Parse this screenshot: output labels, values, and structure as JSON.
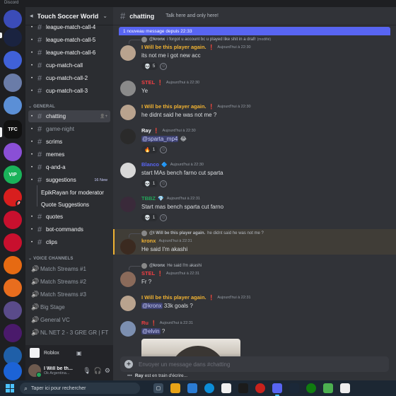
{
  "app": {
    "title": "Discord"
  },
  "rail": {
    "servers": [
      {
        "label": "",
        "color": "#3b4cb8"
      },
      {
        "label": "",
        "color": "#1a2340",
        "badge": ""
      },
      {
        "label": "",
        "color": "#4061d8"
      },
      {
        "label": "",
        "color": "#6a7ca8"
      },
      {
        "label": "",
        "color": "#5b8fd6"
      },
      {
        "label": "TFC",
        "color": "#111111"
      },
      {
        "label": "",
        "color": "#8a4fd6"
      },
      {
        "label": "VIP",
        "color": "#1ab35a"
      },
      {
        "label": "",
        "color": "#d81e1e",
        "badge": "1"
      },
      {
        "label": "",
        "color": "#c8102e"
      },
      {
        "label": "",
        "color": "#c8102e"
      },
      {
        "label": "",
        "color": "#e66a12"
      },
      {
        "label": "",
        "color": "#e86d1e",
        "badge": ""
      },
      {
        "label": "",
        "color": "#5a4b8a"
      },
      {
        "label": "",
        "color": "#4a1a6b"
      },
      {
        "label": "",
        "color": "#1f5fa8"
      },
      {
        "label": "",
        "color": "#1c63d6"
      }
    ]
  },
  "guild": {
    "name": "Touch Soccer World"
  },
  "sidebar": {
    "top_channels": [
      {
        "name": "league-match-call-4"
      },
      {
        "name": "league-match-call-5"
      },
      {
        "name": "league-match-call-6"
      },
      {
        "name": "cup-match-call"
      },
      {
        "name": "cup-match-call-2"
      },
      {
        "name": "cup-match-call-3"
      }
    ],
    "category_general": "GENERAL",
    "general_channels": [
      {
        "name": "chatting",
        "active": true
      },
      {
        "name": "game-night",
        "dim": true
      },
      {
        "name": "scrims"
      },
      {
        "name": "memes"
      },
      {
        "name": "q-and-a"
      },
      {
        "name": "suggestions",
        "badge": "16 New"
      }
    ],
    "threads": [
      "EpikRayan for moderator",
      "Quote Suggestions"
    ],
    "more_channels": [
      {
        "name": "quotes"
      },
      {
        "name": "bot-commands"
      },
      {
        "name": "clips"
      }
    ],
    "category_voice": "VOICE CHANNELS",
    "voice_channels": [
      {
        "name": "Match Streams #1"
      },
      {
        "name": "Match Streams #2"
      },
      {
        "name": "Match Streams #3"
      },
      {
        "name": "Big Stage"
      },
      {
        "name": "General VC"
      },
      {
        "name": "NL NET 2 - 3 GRE GR | FT"
      }
    ]
  },
  "activity": {
    "label": "Roblox"
  },
  "user": {
    "name": "I Will be th...",
    "status": "Ok Argentina..."
  },
  "channel": {
    "name": "chatting",
    "topic": "Talk here and only here!"
  },
  "new_messages_bar": "1 nouveau message depuis 22:33",
  "messages": [
    {
      "reply": {
        "author": "@kronx",
        "text": "i forgot u account bc u played like shit in a drafr",
        "edited": "(modifié)"
      },
      "author": "I Will be this player again.",
      "author_color": "#f0b232",
      "tag": "❗",
      "time": "Aujourd'hui à 22:30",
      "text": "its not me i got new acc",
      "reactions": [
        {
          "emoji": "💀",
          "count": "5"
        }
      ]
    },
    {
      "author": "STEL",
      "author_color": "#f23f43",
      "tag": "❗",
      "time": "Aujourd'hui à 22:30",
      "text": "Ye"
    },
    {
      "author": "I Will be this player again.",
      "author_color": "#f0b232",
      "tag": "❗",
      "time": "Aujourd'hui à 22:30",
      "text": "he didnt said he was not me ?"
    },
    {
      "author": "Ray",
      "author_color": "#f2f3f5",
      "tag": "❗",
      "time": "Aujourd'hui à 22:30",
      "mention": "@sparta_mp4",
      "text": "😂",
      "reactions": [
        {
          "emoji": "🔥",
          "count": "1"
        }
      ]
    },
    {
      "author": "Blanco",
      "author_color": "#5865f2",
      "tag": "🔷",
      "time": "Aujourd'hui à 22:30",
      "text": "start MAs bench farno cut sparta",
      "reactions": [
        {
          "emoji": "💀",
          "count": "1"
        }
      ]
    },
    {
      "author": "TBBZ",
      "author_color": "#23a55a",
      "tag": "💎",
      "time": "Aujourd'hui à 22:31",
      "text": "Start mas bench sparta cut farno",
      "reactions": [
        {
          "emoji": "💀",
          "count": "1"
        }
      ]
    },
    {
      "reply": {
        "author": "@I Will be this player again.",
        "text": "he didnt said he was not me ?"
      },
      "author": "kronx",
      "author_color": "#f0b232",
      "tag": "",
      "time": "Aujourd'hui à 22:31",
      "text": "He said I'm akashi"
    },
    {
      "reply": {
        "author": "@kronx",
        "text": "He said I'm akashi"
      },
      "author": "STEL",
      "author_color": "#f23f43",
      "tag": "❗",
      "time": "Aujourd'hui à 22:31",
      "text": "Fr ?"
    },
    {
      "author": "I Will be this player again.",
      "author_color": "#f0b232",
      "tag": "❗",
      "time": "Aujourd'hui à 22:31",
      "mention": "@kronx",
      "text": "33k goals ?"
    },
    {
      "author": "Ru",
      "author_color": "#f23f43",
      "tag": "❗",
      "time": "Aujourd'hui à 22:31",
      "mention": "@elvin",
      "text": "?"
    }
  ],
  "composer": {
    "placeholder": "Envoyer un message dans #chatting"
  },
  "typing": {
    "user": "Ray",
    "text": "est en train d'écrire..."
  },
  "taskbar": {
    "search_placeholder": "Taper ici pour rechercher"
  }
}
